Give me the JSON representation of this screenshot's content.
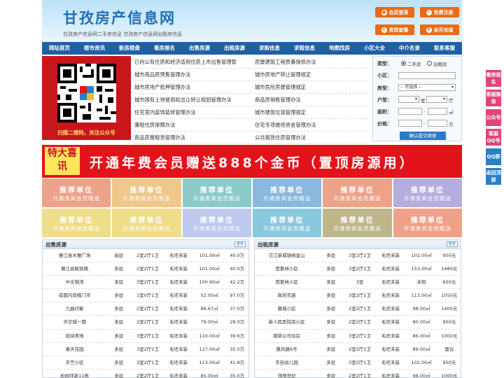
{
  "header": {
    "logo": "甘孜房产信息网",
    "subtitle": "甘孜房产信息网二手房信息   甘孜房产信息网出租房信息",
    "buttons": [
      {
        "label": "会员登录",
        "icon": "user-icon"
      },
      {
        "label": "免费注册",
        "icon": "pen-icon"
      },
      {
        "label": "贵宾套餐",
        "icon": "crown-icon"
      },
      {
        "label": "金币充值",
        "icon": "coin-icon"
      }
    ]
  },
  "nav": [
    "网站首页",
    "楼市资讯",
    "新房楼盘",
    "看房报名",
    "出售房源",
    "出租房源",
    "求购信息",
    "求租信息",
    "地图找房",
    "小区大全",
    "中介名录",
    "联系客服"
  ],
  "qr_caption": "扫描二维码，关注公众号",
  "links_left": [
    "已向公有住房和经济适用住房上市出售管理暂",
    "城市商品房预售管理办法",
    "城市房地产抵押管理办法",
    "城市国有土地使用权出让转让规划管理办法",
    "住宅室内装饰装修管理办法",
    "廉租住房保障办法",
    "商品房屋租赁管理办法"
  ],
  "links_right": [
    "房屋建筑工程质量保修办法",
    "城市房地产转让管理规定",
    "城市危险房屋管理规定",
    "商品房销售管理办法",
    "城市建筑垃圾管理规定",
    "住宅专项维修资金管理办法",
    "公共租赁住房管理办法"
  ],
  "search": {
    "type_label": "类型：",
    "opt1": "二手房",
    "opt2": "出租房",
    "community_label": "小区：",
    "room_label": "房型：",
    "room_select": "-- 可选择 --",
    "huxing_label": "户型：",
    "shi": "室",
    "ting": "厅",
    "area_label": "面积：",
    "area_unit": "㎡",
    "price_label": "价格：",
    "price_unit": "万",
    "dash": "-",
    "submit": "确认提交搜索"
  },
  "banner": {
    "tag": "特大喜讯",
    "text": "开通年费会员赠送888个金币（置顶房源用）"
  },
  "unit_title": "推荐单位",
  "unit_sub": "开通贵宾会员赠送",
  "unit_colors": [
    "#e3572b",
    "#e39a2b",
    "#2fa0a0",
    "#2b7fc4",
    "#e3572b",
    "#7b6bc4",
    "#e3c32b",
    "#e3c32b",
    "#8a9ee0",
    "#2b9cc4",
    "#8a7d2b",
    "#e3572b"
  ],
  "sale": {
    "title": "出售房源",
    "more": "更多",
    "rows": [
      [
        "雅江县木雅广场",
        "高层",
        "2室2厅1卫",
        "毛坯未装",
        "101.00㎡",
        "40.0万"
      ],
      [
        "雅江县解放路",
        "多层",
        "2室2厅1卫",
        "毛坯未装",
        "101.00㎡",
        "40.0万"
      ],
      [
        "中文锦湾",
        "多层",
        "3室2厅1卫",
        "毛坯未装",
        "100.90㎡",
        "42.2万"
      ],
      [
        "成都内双楠门市",
        "多层",
        "1室0厅1卫",
        "毛坯未装",
        "52.00㎡",
        "97.0万"
      ],
      [
        "九曲印象",
        "多层",
        "2室2厅1卫",
        "毛坯未装",
        "88.67㎡",
        "37.0万"
      ],
      [
        "天空城一期",
        "多层",
        "2室2厅1卫",
        "毛坯未装",
        "79.00㎡",
        "28.0万"
      ],
      [
        "如诗美地",
        "多层",
        "3室2厅1卫",
        "毛坯未装",
        "110.00㎡",
        "39.6万"
      ],
      [
        "春天花园",
        "多层",
        "3室2厅2卫",
        "毛坯未装",
        "127.00㎡",
        "35.0万"
      ],
      [
        "天竺小区",
        "多层",
        "3室2厅1卫",
        "毛坯未装",
        "113.00㎡",
        "41.8万"
      ],
      [
        "松树坪新11栋",
        "多层",
        "2室2厅1卫",
        "毛坯未装",
        "85.00㎡",
        "35.0万"
      ]
    ]
  },
  "rent": {
    "title": "出租房源",
    "more": "更多",
    "rows": [
      [
        "沱江新城锦绣金山",
        "多层",
        "3室2厅2卫",
        "毛坯未装",
        "102.00㎡",
        "950元"
      ],
      [
        "芭蕉林小区",
        "多层",
        "3室2厅2卫",
        "毛坯未装",
        "153.00㎡",
        "1480元"
      ],
      [
        "芭蕉林小区",
        "多层",
        "3室",
        "毛坯未装",
        "未知",
        "600元"
      ],
      [
        "政府东路",
        "多层",
        "3室2厅1卫",
        "毛坯未装",
        "113.00㎡",
        "1050元"
      ],
      [
        "馨城小区",
        "多层",
        "2室2厅1卫",
        "毛坯未装",
        "98.00㎡",
        "1400元"
      ],
      [
        "新人民医院旁小区",
        "多层",
        "2室2厅1卫",
        "毛坯未装",
        "80.00㎡",
        "900元"
      ],
      [
        "烟草公司住房",
        "多层",
        "3室2厅1卫",
        "毛坯未装",
        "86.00㎡",
        "1000元"
      ],
      [
        "晨风路6号",
        "多层",
        "2室2厅1卫",
        "毛坯未装",
        "89.00㎡",
        "面议"
      ],
      [
        "东街幼儿园",
        "多层",
        "3室2厅1卫",
        "毛坯未装",
        "102.00㎡",
        "950元"
      ],
      [
        "领地世纪",
        "多层",
        "2室2厅1卫",
        "毛坯未装",
        "98.00㎡",
        "1000元"
      ]
    ]
  },
  "side": [
    {
      "label": "看房报名",
      "color": "#e0447a"
    },
    {
      "label": "客服微信",
      "color": "#e0447a"
    },
    {
      "label": "公众号",
      "color": "#e0447a"
    },
    {
      "label": "客服QQ号",
      "color": "#e0447a"
    },
    {
      "label": "QQ群",
      "color": "#2b7fc4"
    },
    {
      "label": "返回顶部",
      "color": "#2b7fc4"
    }
  ]
}
